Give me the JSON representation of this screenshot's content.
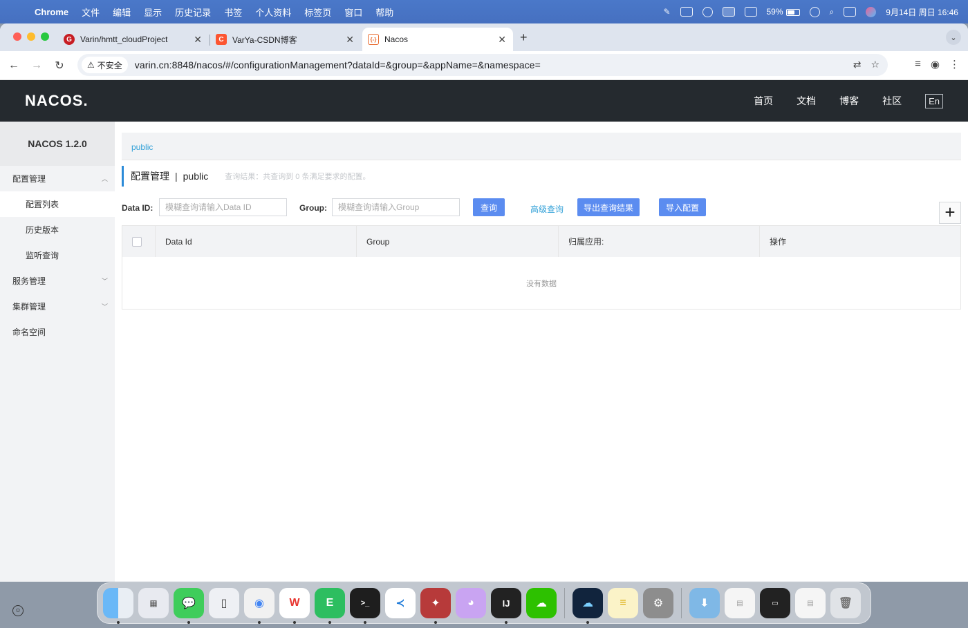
{
  "menubar": {
    "app_name": "Chrome",
    "items": [
      "文件",
      "编辑",
      "显示",
      "历史记录",
      "书签",
      "个人资料",
      "标签页",
      "窗口",
      "帮助"
    ],
    "battery": "59%",
    "datetime": "9月14日 周日  16:46"
  },
  "browser": {
    "tabs": [
      {
        "title": "Varin/hmtt_cloudProject",
        "favicon": "gitee-icon",
        "color": "#c71d23"
      },
      {
        "title": "VarYa-CSDN博客",
        "favicon": "csdn-icon",
        "color": "#fc5531"
      },
      {
        "title": "Nacos",
        "favicon": "nacos-icon",
        "color": "#e8692c"
      }
    ],
    "security_label": "不安全",
    "url": "varin.cn:8848/nacos/#/configurationManagement?dataId=&group=&appName=&namespace="
  },
  "nacos": {
    "logo": "NACOS.",
    "nav": [
      "首页",
      "文档",
      "博客",
      "社区"
    ],
    "lang_button": "En",
    "version": "NACOS 1.2.0",
    "sidebar": {
      "config_group": "配置管理",
      "config_items": [
        "配置列表",
        "历史版本",
        "监听查询"
      ],
      "service_group": "服务管理",
      "cluster_group": "集群管理",
      "namespace": "命名空间"
    },
    "breadcrumb": "public",
    "page_title": "配置管理",
    "title_separator": "|",
    "namespace_name": "public",
    "query_hint": "查询结果：共查询到 0 条满足要求的配置。",
    "filter": {
      "data_id_label": "Data ID:",
      "data_id_placeholder": "模糊查询请输入Data ID",
      "group_label": "Group:",
      "group_placeholder": "模糊查询请输入Group",
      "query_button": "查询",
      "advanced_link": "高级查询",
      "export_button": "导出查询结果",
      "import_button": "导入配置",
      "add_button": "+"
    },
    "table": {
      "columns": [
        "Data Id",
        "Group",
        "归属应用:",
        "操作"
      ],
      "empty_text": "没有数据"
    }
  },
  "dock": {
    "apps": [
      "finder-icon",
      "launchpad-icon",
      "messages-icon",
      "phone-mirror-icon",
      "chrome-icon",
      "wps-icon",
      "evernote-icon",
      "terminal-icon",
      "vscode-icon",
      "kolla-icon",
      "cat-icon",
      "intellij-icon",
      "wechat-icon",
      "baidu-cloud-icon",
      "notes-icon",
      "settings-icon",
      "downloads-folder-icon",
      "trash-icon"
    ]
  }
}
